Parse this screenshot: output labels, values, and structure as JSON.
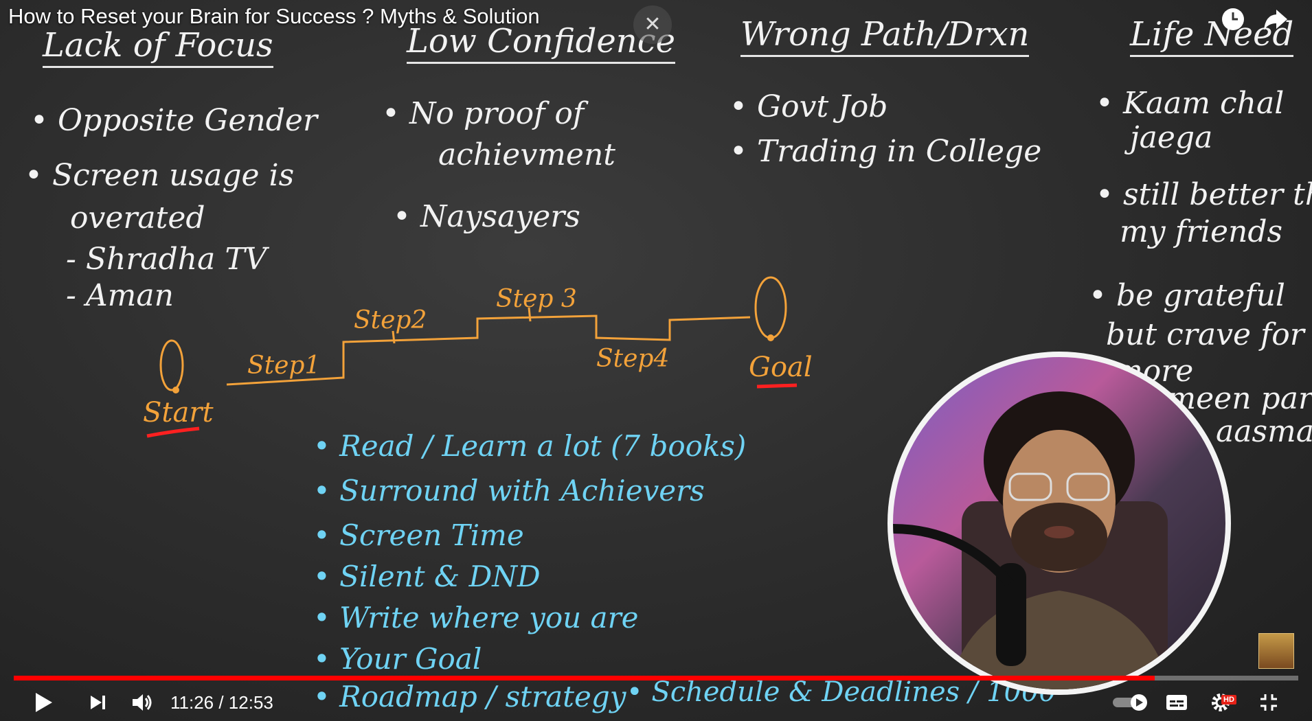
{
  "video": {
    "title": "How to Reset your Brain for Success ? Myths & Solution",
    "current_time": "11:26",
    "duration": "12:53",
    "time_display": "11:26 / 12:53",
    "progress_fraction": 0.888
  },
  "board": {
    "col1": {
      "header": "Lack of Focus",
      "items": [
        "Opposite Gender",
        "Screen usage is",
        "overated",
        "- Shradha TV",
        "- Aman"
      ]
    },
    "col2": {
      "header": "Low Confidence",
      "items": [
        "No proof of",
        "achievment",
        "Naysayers"
      ]
    },
    "col3": {
      "header": "Wrong Path/Drxn",
      "items": [
        "Govt Job",
        "Trading in College"
      ]
    },
    "col4": {
      "header": "Life Need",
      "items": [
        "Kaam chal",
        "jaega",
        "still better than",
        "my friends",
        "be grateful",
        "but crave for",
        "more",
        "zameen par",
        "aasman"
      ]
    },
    "diagram": {
      "start": "Start",
      "step1": "Step1",
      "step2": "Step2",
      "step3": "Step 3",
      "step4": "Step4",
      "goal": "Goal"
    },
    "solutions": [
      "Read / Learn a lot (7 books)",
      "Surround with Achievers",
      "Screen Time",
      "Silent & DND",
      "Write where you are",
      "Your Goal",
      "Roadmap / strategy",
      "Schedule & Deadlines / 1000"
    ]
  },
  "icons": {
    "close": "close-icon",
    "watch_later": "clock-icon",
    "share": "share-icon",
    "play": "play-icon",
    "next": "next-icon",
    "volume": "volume-icon",
    "autoplay": "autoplay-toggle-icon",
    "captions": "captions-icon",
    "settings": "gear-icon",
    "fullscreen": "exit-fullscreen-icon"
  },
  "settings_badge": "HD",
  "colors": {
    "board": "#2e2e2e",
    "chalk_white": "#f2f2f2",
    "chalk_orange": "#f3a23a",
    "chalk_cyan": "#6fd3f4",
    "progress": "#ff0000",
    "underline_red": "#ff2020"
  }
}
